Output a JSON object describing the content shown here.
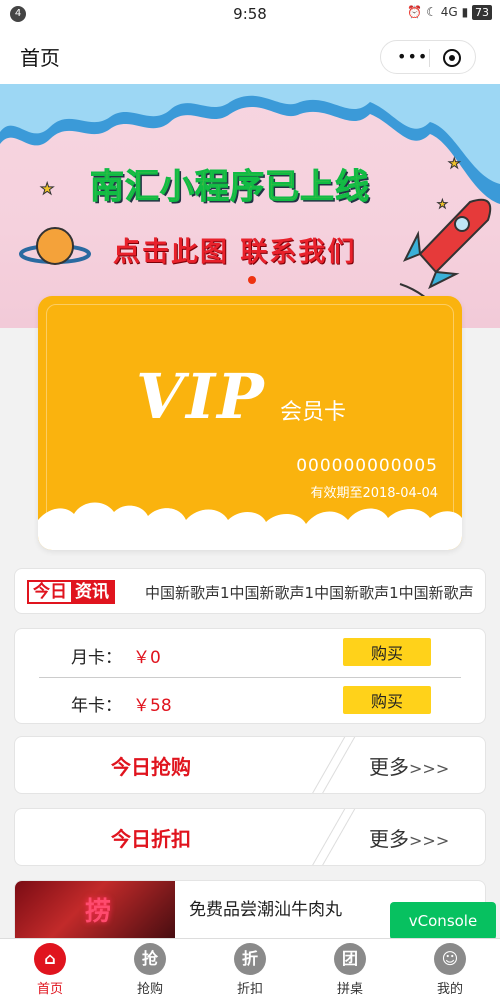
{
  "status_bar": {
    "notif_count": "4",
    "time": "9:58",
    "network": "4G",
    "battery": "73"
  },
  "nav": {
    "title": "首页"
  },
  "banner": {
    "headline": "南汇小程序已上线",
    "subline": "点击此图  联系我们"
  },
  "vip_card": {
    "vip": "VIP",
    "member_label": "会员卡",
    "card_no": "000000000005",
    "valid": "有效期至2018-04-04"
  },
  "news": {
    "tag_a": "今日",
    "tag_b": "资讯",
    "text": "中国新歌声1中国新歌声1中国新歌声1中国新歌声1中国新歌声1"
  },
  "cards": [
    {
      "label": "月卡：",
      "price": "￥0",
      "buy": "购买"
    },
    {
      "label": "年卡：",
      "price": "￥58",
      "buy": "购买"
    }
  ],
  "promos": [
    {
      "title": "今日抢购",
      "more": "更多",
      "arrows": ">>>"
    },
    {
      "title": "今日折扣",
      "more": "更多",
      "arrows": ">>>"
    }
  ],
  "item": {
    "name": "免费品尝潮汕牛肉丸",
    "thumb_text": "捞"
  },
  "vconsole": "vConsole",
  "tabs": [
    {
      "icon": "⌂",
      "label": "首页",
      "active": true
    },
    {
      "icon": "抢",
      "label": "抢购",
      "active": false
    },
    {
      "icon": "折",
      "label": "折扣",
      "active": false
    },
    {
      "icon": "团",
      "label": "拼桌",
      "active": false
    },
    {
      "icon": "☺",
      "label": "我的",
      "active": false
    }
  ]
}
